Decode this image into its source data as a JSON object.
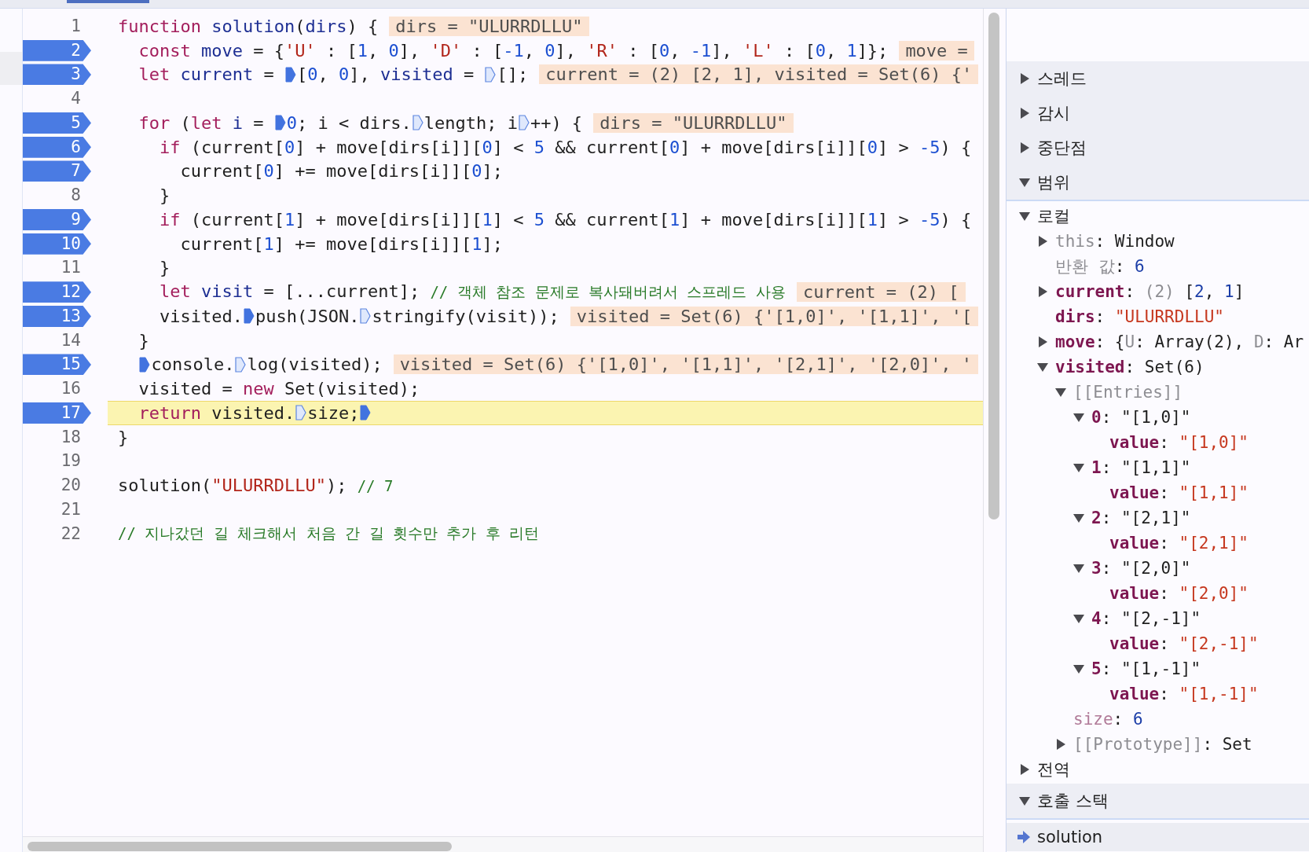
{
  "editor": {
    "lines": [
      {
        "number": "1",
        "breakpoint": false,
        "paused": false,
        "tokens": [
          {
            "kind": "keyword",
            "text": "function "
          },
          {
            "kind": "name",
            "text": "solution"
          },
          {
            "kind": "plain",
            "text": "("
          },
          {
            "kind": "name",
            "text": "dirs"
          },
          {
            "kind": "plain",
            "text": ") {"
          }
        ],
        "inline_value": "dirs = \"ULURRDLLU\""
      },
      {
        "number": "2",
        "breakpoint": true,
        "paused": false,
        "tokens": [
          {
            "kind": "keyword",
            "text": "  const "
          },
          {
            "kind": "name",
            "text": "move"
          },
          {
            "kind": "plain",
            "text": " = {"
          },
          {
            "kind": "string",
            "text": "'U'"
          },
          {
            "kind": "plain",
            "text": " : ["
          },
          {
            "kind": "number",
            "text": "1"
          },
          {
            "kind": "plain",
            "text": ", "
          },
          {
            "kind": "number",
            "text": "0"
          },
          {
            "kind": "plain",
            "text": "], "
          },
          {
            "kind": "string",
            "text": "'D'"
          },
          {
            "kind": "plain",
            "text": " : ["
          },
          {
            "kind": "number",
            "text": "-1"
          },
          {
            "kind": "plain",
            "text": ", "
          },
          {
            "kind": "number",
            "text": "0"
          },
          {
            "kind": "plain",
            "text": "], "
          },
          {
            "kind": "string",
            "text": "'R'"
          },
          {
            "kind": "plain",
            "text": " : ["
          },
          {
            "kind": "number",
            "text": "0"
          },
          {
            "kind": "plain",
            "text": ", "
          },
          {
            "kind": "number",
            "text": "-1"
          },
          {
            "kind": "plain",
            "text": "], "
          },
          {
            "kind": "string",
            "text": "'L'"
          },
          {
            "kind": "plain",
            "text": " : ["
          },
          {
            "kind": "number",
            "text": "0"
          },
          {
            "kind": "plain",
            "text": ", "
          },
          {
            "kind": "number",
            "text": "1"
          },
          {
            "kind": "plain",
            "text": "]};"
          }
        ],
        "inline_value": "move ="
      },
      {
        "number": "3",
        "breakpoint": true,
        "paused": false,
        "tokens": [
          {
            "kind": "keyword",
            "text": "  let "
          },
          {
            "kind": "name",
            "text": "current"
          },
          {
            "kind": "plain",
            "text": " = "
          },
          {
            "kind": "step",
            "active": true
          },
          {
            "kind": "plain",
            "text": "["
          },
          {
            "kind": "number",
            "text": "0"
          },
          {
            "kind": "plain",
            "text": ", "
          },
          {
            "kind": "number",
            "text": "0"
          },
          {
            "kind": "plain",
            "text": "], "
          },
          {
            "kind": "name",
            "text": "visited"
          },
          {
            "kind": "plain",
            "text": " = "
          },
          {
            "kind": "step",
            "active": false
          },
          {
            "kind": "plain",
            "text": "[];"
          }
        ],
        "inline_value": "current = (2) [2, 1], visited = Set(6) {'"
      },
      {
        "number": "4",
        "breakpoint": false,
        "paused": false
      },
      {
        "number": "5",
        "breakpoint": true,
        "paused": false,
        "tokens": [
          {
            "kind": "keyword",
            "text": "  for"
          },
          {
            "kind": "plain",
            "text": " ("
          },
          {
            "kind": "keyword",
            "text": "let "
          },
          {
            "kind": "name",
            "text": "i"
          },
          {
            "kind": "plain",
            "text": " = "
          },
          {
            "kind": "step",
            "active": true
          },
          {
            "kind": "number",
            "text": "0"
          },
          {
            "kind": "plain",
            "text": "; i < dirs."
          },
          {
            "kind": "step",
            "active": false
          },
          {
            "kind": "plain",
            "text": "length; i"
          },
          {
            "kind": "step",
            "active": false
          },
          {
            "kind": "plain",
            "text": "++) {"
          }
        ],
        "inline_value": "dirs = \"ULURRDLLU\""
      },
      {
        "number": "6",
        "breakpoint": true,
        "paused": false,
        "tokens": [
          {
            "kind": "keyword",
            "text": "    if"
          },
          {
            "kind": "plain",
            "text": " (current["
          },
          {
            "kind": "number",
            "text": "0"
          },
          {
            "kind": "plain",
            "text": "] + move[dirs[i]]["
          },
          {
            "kind": "number",
            "text": "0"
          },
          {
            "kind": "plain",
            "text": "] < "
          },
          {
            "kind": "number",
            "text": "5"
          },
          {
            "kind": "plain",
            "text": " && current["
          },
          {
            "kind": "number",
            "text": "0"
          },
          {
            "kind": "plain",
            "text": "] + move[dirs[i]]["
          },
          {
            "kind": "number",
            "text": "0"
          },
          {
            "kind": "plain",
            "text": "] > "
          },
          {
            "kind": "number",
            "text": "-5"
          },
          {
            "kind": "plain",
            "text": ") {"
          }
        ]
      },
      {
        "number": "7",
        "breakpoint": true,
        "paused": false,
        "tokens": [
          {
            "kind": "plain",
            "text": "      current["
          },
          {
            "kind": "number",
            "text": "0"
          },
          {
            "kind": "plain",
            "text": "] += move[dirs[i]]["
          },
          {
            "kind": "number",
            "text": "0"
          },
          {
            "kind": "plain",
            "text": "];"
          }
        ]
      },
      {
        "number": "8",
        "breakpoint": false,
        "paused": false,
        "tokens": [
          {
            "kind": "plain",
            "text": "    }"
          }
        ]
      },
      {
        "number": "9",
        "breakpoint": true,
        "paused": false,
        "tokens": [
          {
            "kind": "keyword",
            "text": "    if"
          },
          {
            "kind": "plain",
            "text": " (current["
          },
          {
            "kind": "number",
            "text": "1"
          },
          {
            "kind": "plain",
            "text": "] + move[dirs[i]]["
          },
          {
            "kind": "number",
            "text": "1"
          },
          {
            "kind": "plain",
            "text": "] < "
          },
          {
            "kind": "number",
            "text": "5"
          },
          {
            "kind": "plain",
            "text": " && current["
          },
          {
            "kind": "number",
            "text": "1"
          },
          {
            "kind": "plain",
            "text": "] + move[dirs[i]]["
          },
          {
            "kind": "number",
            "text": "1"
          },
          {
            "kind": "plain",
            "text": "] > "
          },
          {
            "kind": "number",
            "text": "-5"
          },
          {
            "kind": "plain",
            "text": ") {"
          }
        ]
      },
      {
        "number": "10",
        "breakpoint": true,
        "paused": false,
        "tokens": [
          {
            "kind": "plain",
            "text": "      current["
          },
          {
            "kind": "number",
            "text": "1"
          },
          {
            "kind": "plain",
            "text": "] += move[dirs[i]]["
          },
          {
            "kind": "number",
            "text": "1"
          },
          {
            "kind": "plain",
            "text": "];"
          }
        ]
      },
      {
        "number": "11",
        "breakpoint": false,
        "paused": false,
        "tokens": [
          {
            "kind": "plain",
            "text": "    }"
          }
        ]
      },
      {
        "number": "12",
        "breakpoint": true,
        "paused": false,
        "tokens": [
          {
            "kind": "keyword",
            "text": "    let "
          },
          {
            "kind": "name",
            "text": "visit"
          },
          {
            "kind": "plain",
            "text": " = [...current]; "
          },
          {
            "kind": "comment",
            "text": "// 객체 참조 문제로 복사돼버려서 스프레드 사용"
          }
        ],
        "inline_value": "current = (2) ["
      },
      {
        "number": "13",
        "breakpoint": true,
        "paused": false,
        "tokens": [
          {
            "kind": "plain",
            "text": "    visited."
          },
          {
            "kind": "step",
            "active": true
          },
          {
            "kind": "plain",
            "text": "push(JSON."
          },
          {
            "kind": "step",
            "active": false
          },
          {
            "kind": "plain",
            "text": "stringify(visit));"
          }
        ],
        "inline_value": "visited = Set(6) {'[1,0]', '[1,1]', '["
      },
      {
        "number": "14",
        "breakpoint": false,
        "paused": false,
        "tokens": [
          {
            "kind": "plain",
            "text": "  }"
          }
        ]
      },
      {
        "number": "15",
        "breakpoint": true,
        "paused": false,
        "tokens": [
          {
            "kind": "step",
            "active": true
          },
          {
            "kind": "plain",
            "text": "console."
          },
          {
            "kind": "step",
            "active": false
          },
          {
            "kind": "plain",
            "text": "log(visited);"
          }
        ],
        "inline_value": "visited = Set(6) {'[1,0]', '[1,1]', '[2,1]', '[2,0]', '"
      },
      {
        "number": "16",
        "breakpoint": false,
        "paused": false,
        "tokens": [
          {
            "kind": "plain",
            "text": "  visited = "
          },
          {
            "kind": "keyword",
            "text": "new"
          },
          {
            "kind": "plain",
            "text": " Set(visited);"
          }
        ]
      },
      {
        "number": "17",
        "breakpoint": true,
        "paused": true,
        "tokens": [
          {
            "kind": "keyword",
            "text": "  return"
          },
          {
            "kind": "plain",
            "text": " visited."
          },
          {
            "kind": "step",
            "active": false
          },
          {
            "kind": "plain",
            "text": "size;"
          },
          {
            "kind": "step",
            "active": true
          }
        ]
      },
      {
        "number": "18",
        "breakpoint": false,
        "paused": false,
        "tokens": [
          {
            "kind": "plain",
            "text": "}"
          }
        ]
      },
      {
        "number": "19",
        "breakpoint": false,
        "paused": false
      },
      {
        "number": "20",
        "breakpoint": false,
        "paused": false,
        "tokens": [
          {
            "kind": "plain",
            "text": "solution("
          },
          {
            "kind": "string",
            "text": "\"ULURRDLLU\""
          },
          {
            "kind": "plain",
            "text": "); "
          },
          {
            "kind": "comment",
            "text": "// 7"
          }
        ]
      },
      {
        "number": "21",
        "breakpoint": false,
        "paused": false
      },
      {
        "number": "22",
        "breakpoint": false,
        "paused": false,
        "tokens": [
          {
            "kind": "comment",
            "text": "// 지나갔던 길 체크해서 처음 간 길 횟수만 추가 후 리턴"
          }
        ]
      }
    ]
  },
  "sidebar": {
    "sections": [
      {
        "label": "스레드",
        "expanded": false
      },
      {
        "label": "감시",
        "expanded": false
      },
      {
        "label": "중단점",
        "expanded": false
      },
      {
        "label": "범위",
        "expanded": true
      }
    ],
    "scope": [
      {
        "kind": "group",
        "expanded": true,
        "key": "로컬",
        "children": [
          {
            "kind": "node",
            "expanded": false,
            "key": "this",
            "color": "#8d8d92",
            "bold": false,
            "value": [
              {
                "kind": "plain",
                "text": ": Window"
              }
            ]
          },
          {
            "kind": "leaf",
            "key": "반환 값",
            "color": "#8d8d92",
            "bold": false,
            "value": [
              {
                "kind": "plain",
                "text": ": "
              },
              {
                "kind": "number",
                "text": "6"
              }
            ]
          },
          {
            "kind": "node",
            "expanded": false,
            "key": "current",
            "color": "#7d1650",
            "bold": true,
            "value": [
              {
                "kind": "plain",
                "text": ": "
              },
              {
                "kind": "meta",
                "text": "(2)"
              },
              {
                "kind": "plain",
                "text": " ["
              },
              {
                "kind": "number",
                "text": "2"
              },
              {
                "kind": "plain",
                "text": ", "
              },
              {
                "kind": "number",
                "text": "1"
              },
              {
                "kind": "plain",
                "text": "]"
              }
            ]
          },
          {
            "kind": "leaf",
            "key": "dirs",
            "color": "#7d1650",
            "bold": true,
            "value": [
              {
                "kind": "plain",
                "text": ": "
              },
              {
                "kind": "string",
                "text": "\"ULURRDLLU\""
              }
            ]
          },
          {
            "kind": "node",
            "expanded": false,
            "key": "move",
            "color": "#7d1650",
            "bold": true,
            "value": [
              {
                "kind": "plain",
                "text": ": {"
              },
              {
                "kind": "meta",
                "text": "U"
              },
              {
                "kind": "plain",
                "text": ": Array(2), "
              },
              {
                "kind": "meta",
                "text": "D"
              },
              {
                "kind": "plain",
                "text": ": Ar"
              }
            ]
          },
          {
            "kind": "node",
            "expanded": true,
            "key": "visited",
            "color": "#7d1650",
            "bold": true,
            "value": [
              {
                "kind": "plain",
                "text": ": Set(6)"
              }
            ],
            "children": [
              {
                "kind": "node",
                "expanded": true,
                "key": "[[Entries]]",
                "color": "#8d8d92",
                "bold": false,
                "children": [
                  {
                    "kind": "node",
                    "expanded": true,
                    "key": "0",
                    "color": "#7d1650",
                    "bold": true,
                    "value": [
                      {
                        "kind": "plain",
                        "text": ": \"[1,0]\""
                      }
                    ],
                    "children": [
                      {
                        "kind": "leaf",
                        "key": "value",
                        "color": "#7d1650",
                        "bold": true,
                        "value": [
                          {
                            "kind": "plain",
                            "text": ": "
                          },
                          {
                            "kind": "string",
                            "text": "\"[1,0]\""
                          }
                        ]
                      }
                    ]
                  },
                  {
                    "kind": "node",
                    "expanded": true,
                    "key": "1",
                    "color": "#7d1650",
                    "bold": true,
                    "value": [
                      {
                        "kind": "plain",
                        "text": ": \"[1,1]\""
                      }
                    ],
                    "children": [
                      {
                        "kind": "leaf",
                        "key": "value",
                        "color": "#7d1650",
                        "bold": true,
                        "value": [
                          {
                            "kind": "plain",
                            "text": ": "
                          },
                          {
                            "kind": "string",
                            "text": "\"[1,1]\""
                          }
                        ]
                      }
                    ]
                  },
                  {
                    "kind": "node",
                    "expanded": true,
                    "key": "2",
                    "color": "#7d1650",
                    "bold": true,
                    "value": [
                      {
                        "kind": "plain",
                        "text": ": \"[2,1]\""
                      }
                    ],
                    "children": [
                      {
                        "kind": "leaf",
                        "key": "value",
                        "color": "#7d1650",
                        "bold": true,
                        "value": [
                          {
                            "kind": "plain",
                            "text": ": "
                          },
                          {
                            "kind": "string",
                            "text": "\"[2,1]\""
                          }
                        ]
                      }
                    ]
                  },
                  {
                    "kind": "node",
                    "expanded": true,
                    "key": "3",
                    "color": "#7d1650",
                    "bold": true,
                    "value": [
                      {
                        "kind": "plain",
                        "text": ": \"[2,0]\""
                      }
                    ],
                    "children": [
                      {
                        "kind": "leaf",
                        "key": "value",
                        "color": "#7d1650",
                        "bold": true,
                        "value": [
                          {
                            "kind": "plain",
                            "text": ": "
                          },
                          {
                            "kind": "string",
                            "text": "\"[2,0]\""
                          }
                        ]
                      }
                    ]
                  },
                  {
                    "kind": "node",
                    "expanded": true,
                    "key": "4",
                    "color": "#7d1650",
                    "bold": true,
                    "value": [
                      {
                        "kind": "plain",
                        "text": ": \"[2,-1]\""
                      }
                    ],
                    "children": [
                      {
                        "kind": "leaf",
                        "key": "value",
                        "color": "#7d1650",
                        "bold": true,
                        "value": [
                          {
                            "kind": "plain",
                            "text": ": "
                          },
                          {
                            "kind": "string",
                            "text": "\"[2,-1]\""
                          }
                        ]
                      }
                    ]
                  },
                  {
                    "kind": "node",
                    "expanded": true,
                    "key": "5",
                    "color": "#7d1650",
                    "bold": true,
                    "value": [
                      {
                        "kind": "plain",
                        "text": ": \"[1,-1]\""
                      }
                    ],
                    "children": [
                      {
                        "kind": "leaf",
                        "key": "value",
                        "color": "#7d1650",
                        "bold": true,
                        "value": [
                          {
                            "kind": "plain",
                            "text": ": "
                          },
                          {
                            "kind": "string",
                            "text": "\"[1,-1]\""
                          }
                        ]
                      }
                    ]
                  }
                ]
              },
              {
                "kind": "leaf",
                "key": "size",
                "color": "#b07a98",
                "bold": false,
                "value": [
                  {
                    "kind": "plain",
                    "text": ": "
                  },
                  {
                    "kind": "number",
                    "text": "6"
                  }
                ]
              },
              {
                "kind": "node",
                "expanded": false,
                "key": "[[Prototype]]",
                "color": "#8d8d92",
                "bold": false,
                "value": [
                  {
                    "kind": "plain",
                    "text": ": Set"
                  }
                ]
              }
            ]
          }
        ]
      },
      {
        "kind": "group",
        "expanded": false,
        "key": "전역"
      }
    ],
    "call_stack": {
      "label": "호출 스택",
      "expanded": true,
      "frames": [
        {
          "name": "solution",
          "selected": true
        }
      ]
    }
  }
}
